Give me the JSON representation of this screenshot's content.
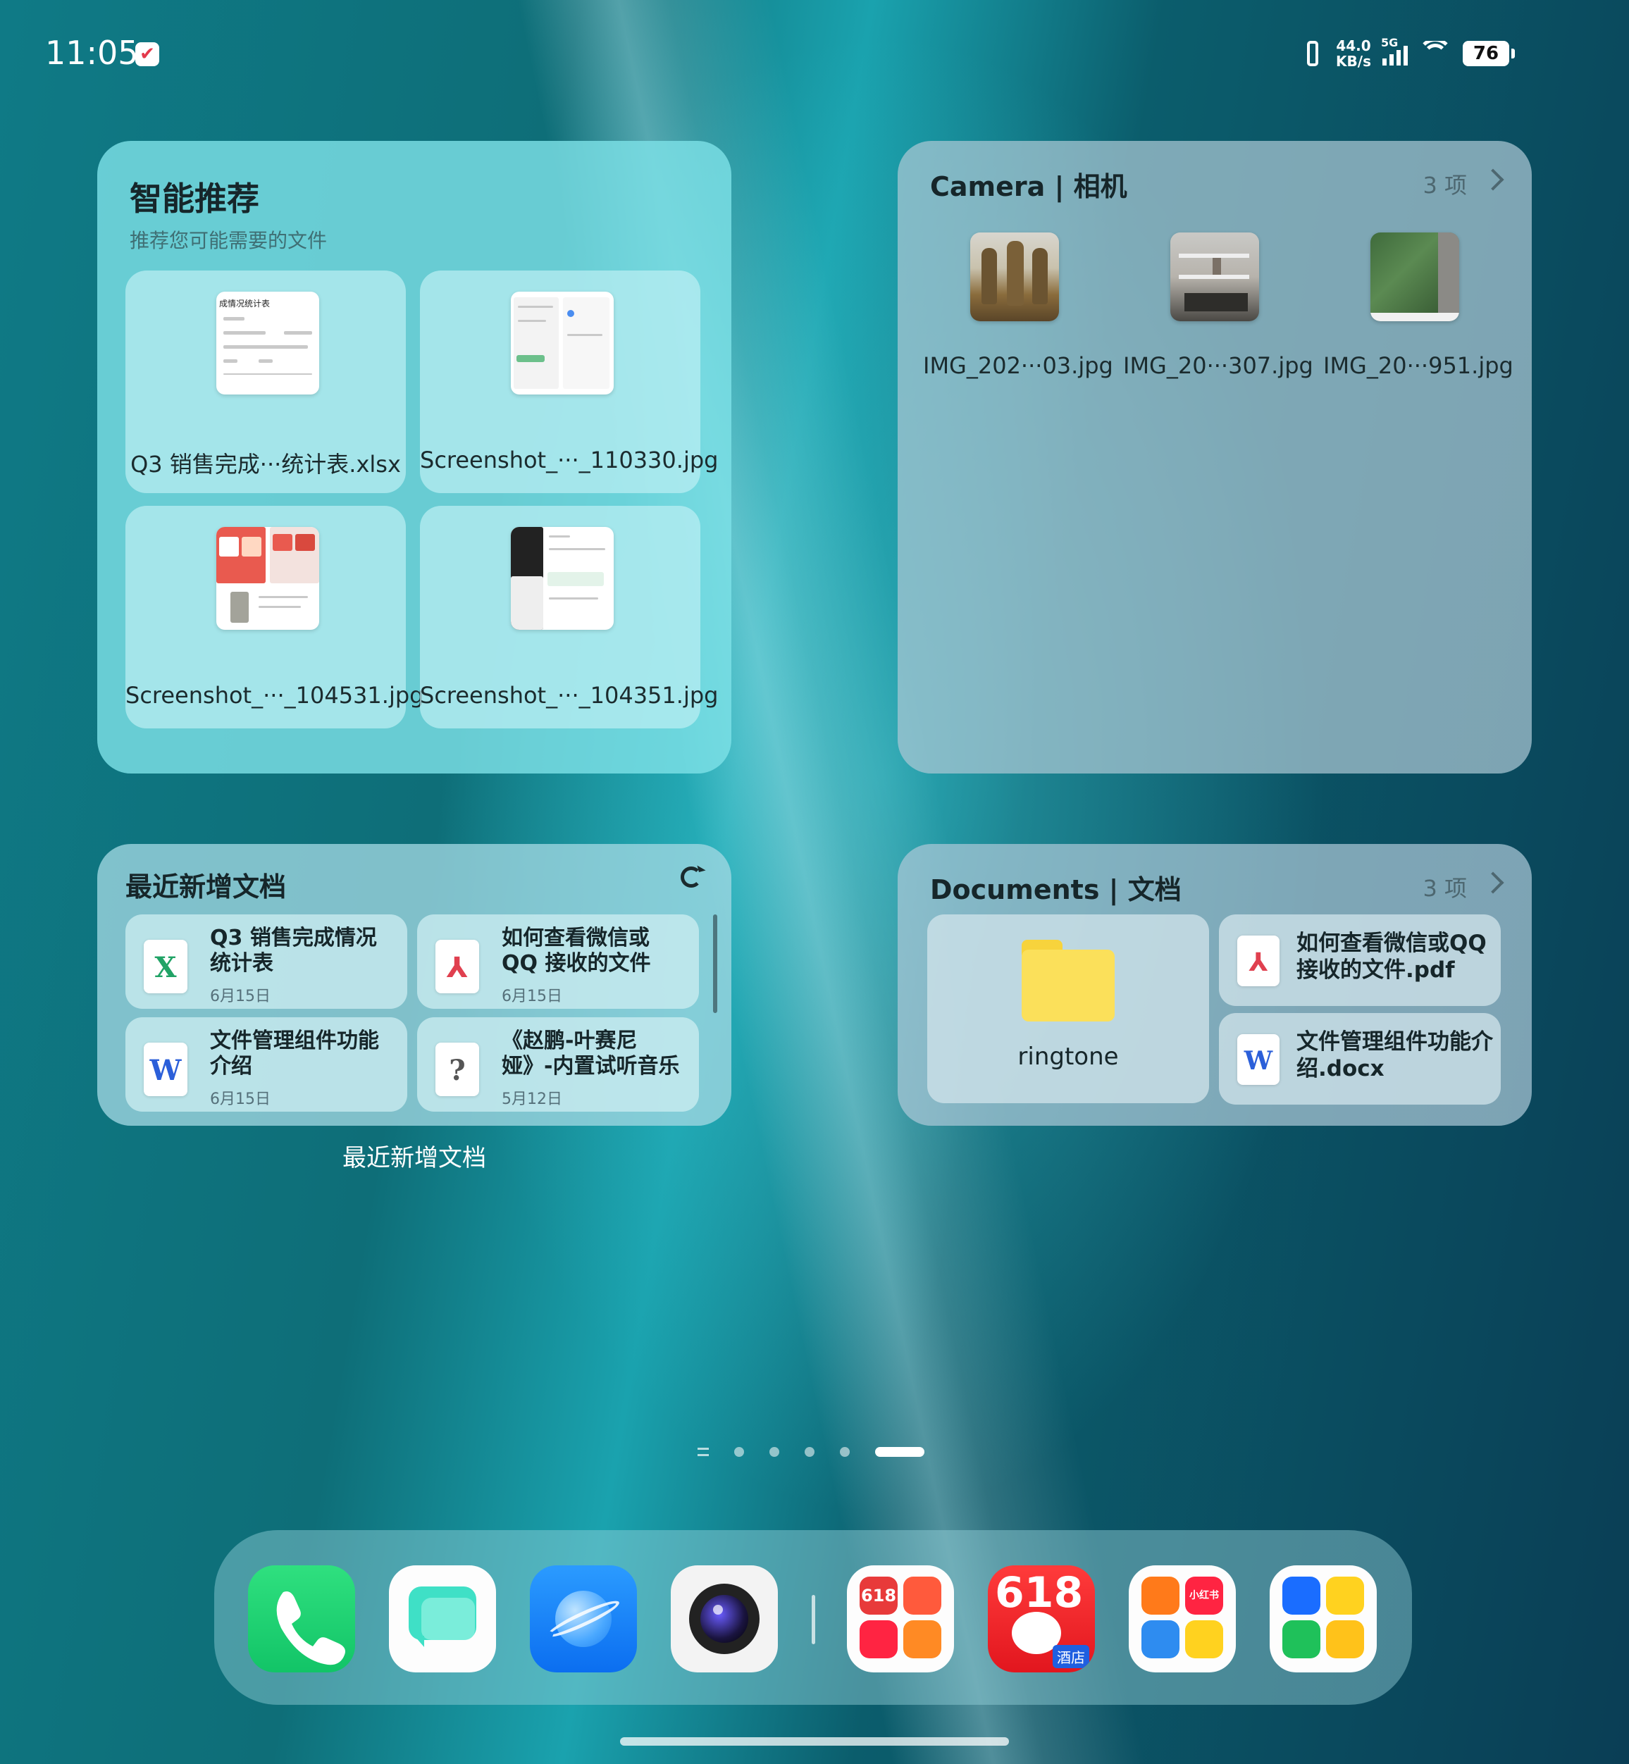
{
  "status_bar": {
    "time": "11:05",
    "net_speed_value": "44.0",
    "net_speed_unit": "KB/s",
    "network_type": "5G",
    "battery": "76"
  },
  "smart_widget": {
    "title": "智能推荐",
    "subtitle": "推荐您可能需要的文件",
    "files": [
      {
        "name": "Q3 销售完成···统计表.xlsx",
        "thumb_text": "成情况统计表"
      },
      {
        "name": "Screenshot_···_110330.jpg"
      },
      {
        "name": "Screenshot_···_104531.jpg"
      },
      {
        "name": "Screenshot_···_104351.jpg"
      }
    ]
  },
  "camera_widget": {
    "title": "Camera | 相机",
    "count": "3 项",
    "photos": [
      {
        "name": "IMG_202···03.jpg"
      },
      {
        "name": "IMG_20···307.jpg"
      },
      {
        "name": "IMG_20···951.jpg"
      }
    ]
  },
  "recent_widget": {
    "title": "最近新增文档",
    "label_below": "最近新增文档",
    "docs": [
      {
        "title": "Q3 销售完成情况统计表",
        "date": "6月15日",
        "icon": "excel-icon",
        "glyph": "X",
        "color": "#21a366"
      },
      {
        "title": "如何查看微信或QQ 接收的文件",
        "date": "6月15日",
        "icon": "pdf-icon",
        "glyph": "⅄",
        "color": "#e0404f"
      },
      {
        "title": "文件管理组件功能介绍",
        "date": "6月15日",
        "icon": "word-icon",
        "glyph": "W",
        "color": "#2b5fd9"
      },
      {
        "title": "《赵鹏-叶赛尼娅》-内置试听音乐",
        "date": "5月12日",
        "icon": "unknown-file-icon",
        "glyph": "?",
        "color": "#555555"
      }
    ]
  },
  "documents_widget": {
    "title": "Documents | 文档",
    "count": "3 项",
    "folder": "ringtone",
    "files": [
      {
        "name": "如何查看微信或QQ 接收的文件.pdf",
        "icon": "pdf-icon",
        "glyph": "⅄",
        "color": "#e0404f"
      },
      {
        "name": "文件管理组件功能介绍.docx",
        "icon": "word-icon",
        "glyph": "W",
        "color": "#2b5fd9"
      }
    ]
  },
  "page_indicator": {
    "pages": 6,
    "active": 6
  },
  "dock": {
    "apps": [
      {
        "icon": "phone-app-icon"
      },
      {
        "icon": "messages-app-icon"
      },
      {
        "icon": "browser-app-icon"
      },
      {
        "icon": "camera-app-icon"
      },
      {
        "icon": "folder-618-icon",
        "text": "618"
      },
      {
        "icon": "jd-618-app-icon",
        "text": "618",
        "sub": "酒店"
      },
      {
        "icon": "apps-folder-icon",
        "text": "小红书"
      },
      {
        "icon": "tools-folder-icon"
      }
    ]
  },
  "colors": {
    "accent_teal": "#7de0e6",
    "excel": "#21a366",
    "pdf": "#e0404f",
    "word": "#2b5fd9"
  }
}
